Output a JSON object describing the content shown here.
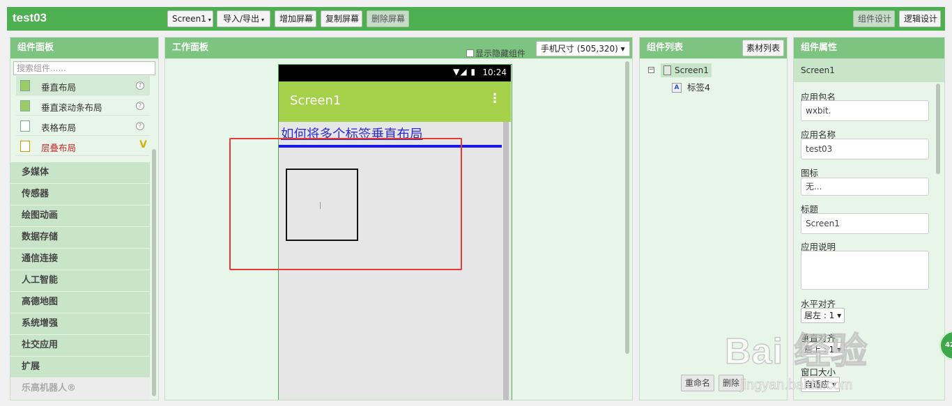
{
  "header": {
    "app_title": "test03",
    "screen_dropdown": "Screen1",
    "import_export": "导入/导出",
    "add_screen": "增加屏幕",
    "copy_screen": "复制屏幕",
    "delete_screen": "删除屏幕",
    "designer": "组件设计",
    "blocks": "逻辑设计"
  },
  "palette": {
    "title": "组件面板",
    "search_placeholder": "搜索组件......",
    "items": [
      {
        "label": "垂直布局"
      },
      {
        "label": "垂直滚动条布局"
      },
      {
        "label": "表格布局"
      },
      {
        "label": "层叠布局",
        "mark": "V"
      }
    ],
    "help_glyph": "?",
    "categories": [
      "多媒体",
      "传感器",
      "绘图动画",
      "数据存储",
      "通信连接",
      "人工智能",
      "高德地图",
      "系统增强",
      "社交应用",
      "扩展",
      "乐高机器人®"
    ]
  },
  "workspace": {
    "title": "工作面板",
    "show_hidden": "显示隐藏组件",
    "size_select": "手机尺寸 (505,320)",
    "phone": {
      "time": "10:24",
      "status_icons": "▼◢ ▮",
      "screen_title": "Screen1",
      "menu_glyph": "⋮",
      "label_text": "如何将多个标签垂直布局"
    }
  },
  "components": {
    "title": "组件列表",
    "assets_button": "素材列表",
    "tree_toggle": "−",
    "screen_node": "Screen1",
    "label_node": "标签4",
    "label_icon": "A",
    "rename_button": "重命名",
    "delete_button": "删除"
  },
  "properties": {
    "title": "组件属性",
    "selected": "Screen1",
    "app_package_label": "应用包名",
    "app_package_value": "wxbit.",
    "app_name_label": "应用名称",
    "app_name_value": "test03",
    "icon_label": "图标",
    "icon_value": "无...",
    "title_label": "标题",
    "title_value": "Screen1",
    "description_label": "应用说明",
    "description_value": "",
    "align_h_label": "水平对齐",
    "align_h_value": "居左 : 1",
    "align_v_label": "垂直对齐",
    "align_v_value": "居上 : 1",
    "window_size_label": "窗口大小",
    "window_size_value": "自适应"
  },
  "watermark": {
    "brand": "Bai 经验",
    "url": "jingyan.baidu.com",
    "badge": "42"
  }
}
